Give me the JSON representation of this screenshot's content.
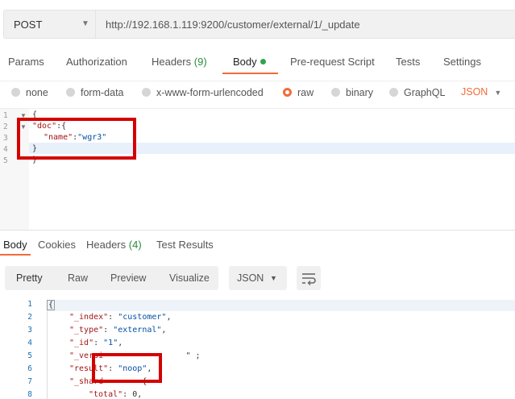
{
  "request": {
    "method": "POST",
    "url": "http://192.168.1.119:9200/customer/external/1/_update"
  },
  "req_tabs": {
    "params": "Params",
    "authorization": "Authorization",
    "headers": "Headers",
    "headers_count": "(9)",
    "body": "Body",
    "pre_request": "Pre-request Script",
    "tests": "Tests",
    "settings": "Settings"
  },
  "body_types": {
    "none": "none",
    "form_data": "form-data",
    "urlencoded": "x-www-form-urlencoded",
    "raw": "raw",
    "binary": "binary",
    "graphql": "GraphQL",
    "format": "JSON",
    "selected": "raw"
  },
  "request_editor": {
    "line_numbers": [
      "1",
      "2",
      "3",
      "4",
      "5"
    ],
    "line1": "{",
    "line2_key": "\"doc\"",
    "line2_rest": ":{",
    "line3_key": "\"name\"",
    "line3_colon": ":",
    "line3_val": "\"wgr3\"",
    "line4": "}",
    "line5": "}"
  },
  "res_tabs": {
    "body": "Body",
    "cookies": "Cookies",
    "headers": "Headers",
    "headers_count": "(4)",
    "test_results": "Test Results"
  },
  "res_toolbar": {
    "pretty": "Pretty",
    "raw": "Raw",
    "preview": "Preview",
    "visualize": "Visualize",
    "format": "JSON"
  },
  "response_editor": {
    "line_numbers": [
      "1",
      "2",
      "3",
      "4",
      "5",
      "6",
      "7",
      "8"
    ],
    "l1": "{",
    "l2_key": "\"_index\"",
    "l2_val": "\"customer\"",
    "l3_key": "\"_type\"",
    "l3_val": "\"external\"",
    "l4_key": "\"_id\"",
    "l4_val": "\"1\"",
    "l5_key": "\"_versi",
    "l5_tail": "\" ;",
    "l6_key": "\"result\"",
    "l6_val": "\"noop\"",
    "l7_key": "\"_shard",
    "l7_tail": "{",
    "l8_key": "\"total\"",
    "l8_val": "0"
  }
}
